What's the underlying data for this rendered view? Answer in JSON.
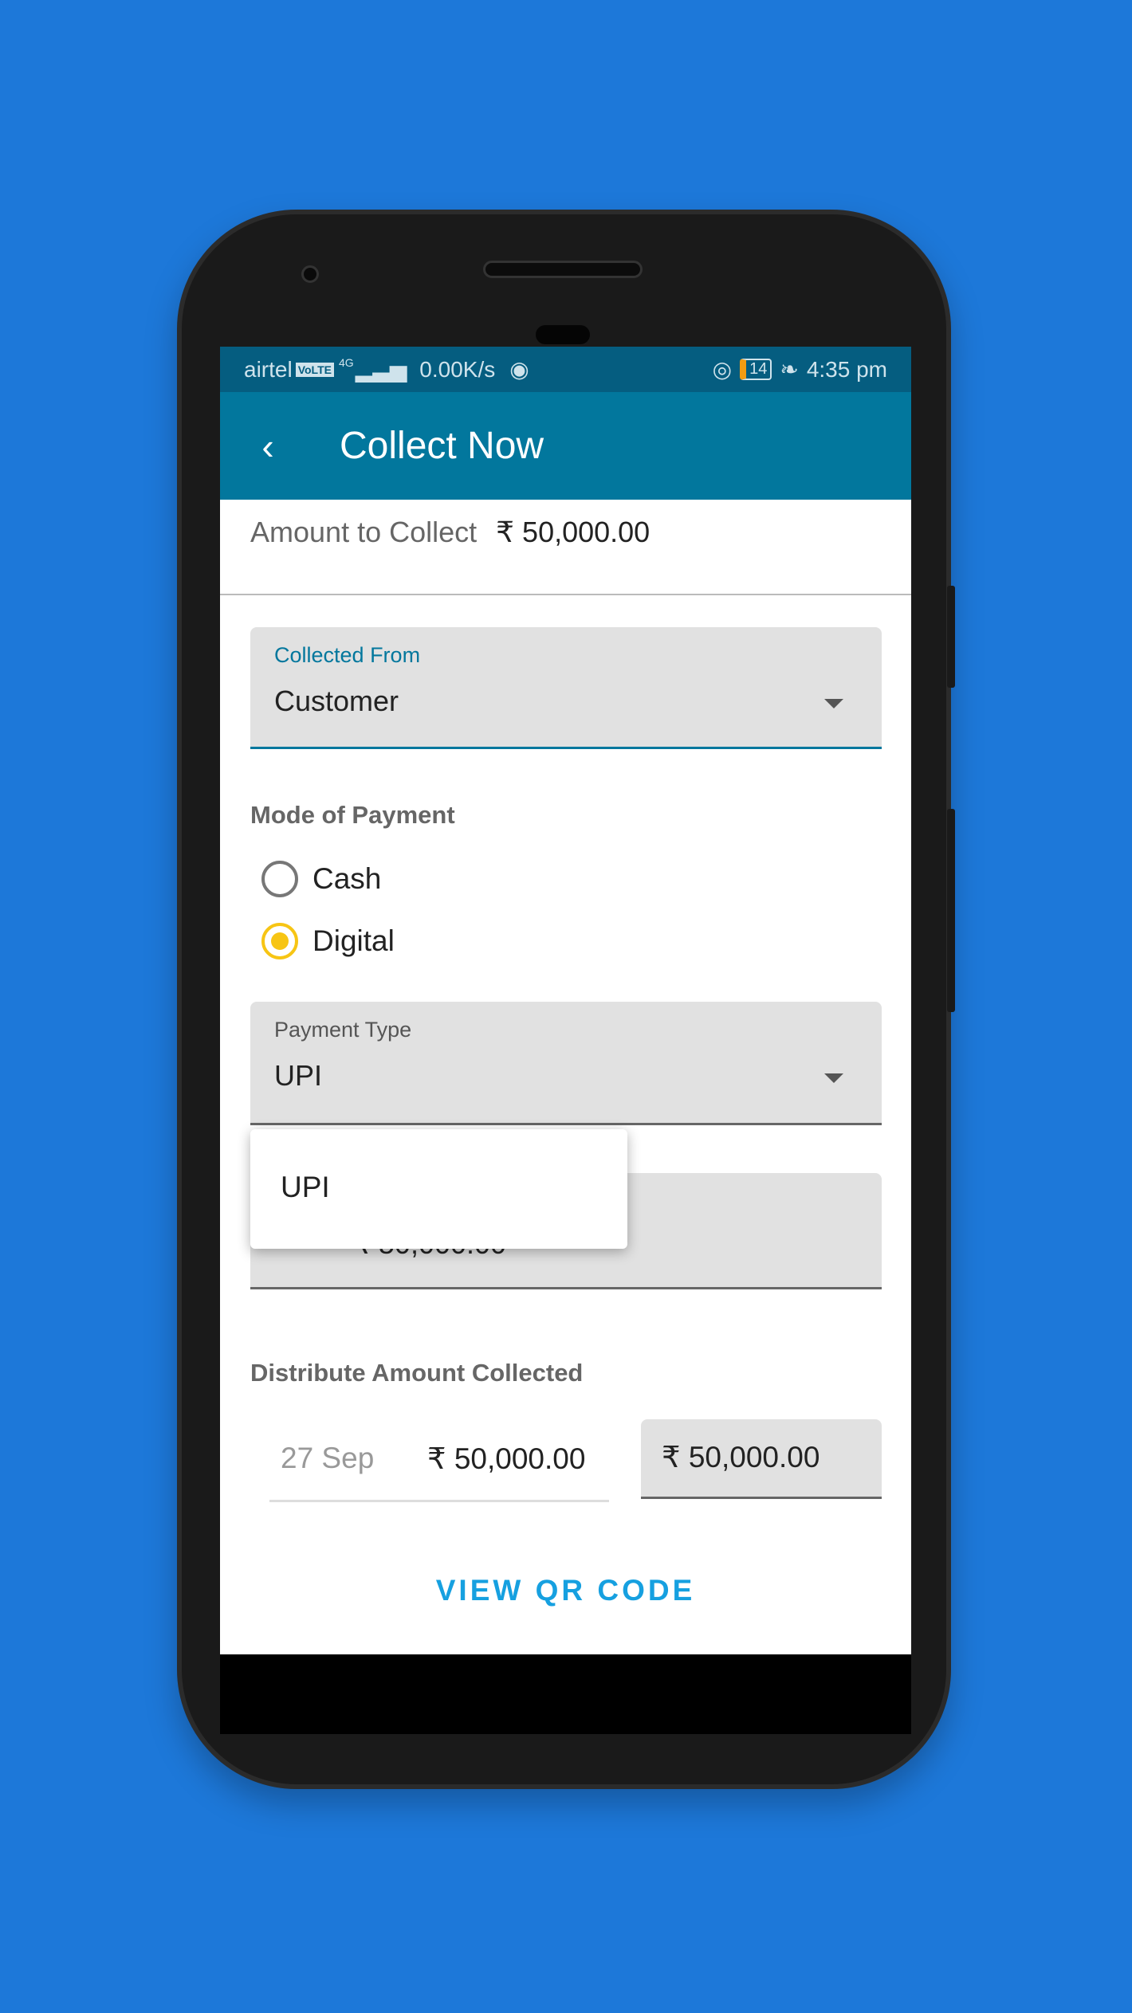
{
  "status_bar": {
    "carrier": "airtel",
    "volte": "VoLTE",
    "network": "4G",
    "speed": "0.00K/s",
    "battery": "14",
    "time": "4:35 pm"
  },
  "header": {
    "title": "Collect Now",
    "back_icon": "chevron-left-icon"
  },
  "amount": {
    "label": "Amount to Collect",
    "value": "₹ 50,000.00"
  },
  "collected_from": {
    "label": "Collected From",
    "value": "Customer"
  },
  "mode": {
    "label": "Mode of Payment",
    "options": [
      {
        "label": "Cash",
        "selected": false
      },
      {
        "label": "Digital",
        "selected": true
      }
    ]
  },
  "payment_type": {
    "label": "Payment Type",
    "value": "UPI",
    "menu_options": [
      "UPI"
    ]
  },
  "hidden_amount": {
    "value": "₹ 50,000.00"
  },
  "distribute": {
    "label": "Distribute Amount Collected",
    "date": "27 Sep",
    "amount": "₹ 50,000.00",
    "input_value": "₹ 50,000.00"
  },
  "actions": {
    "view_qr": "VIEW QR CODE"
  },
  "colors": {
    "background": "#1d78d9",
    "appbar": "#02779d",
    "status_bar": "#055d80",
    "accent": "#16a0e0",
    "radio_selected": "#f7c514"
  }
}
